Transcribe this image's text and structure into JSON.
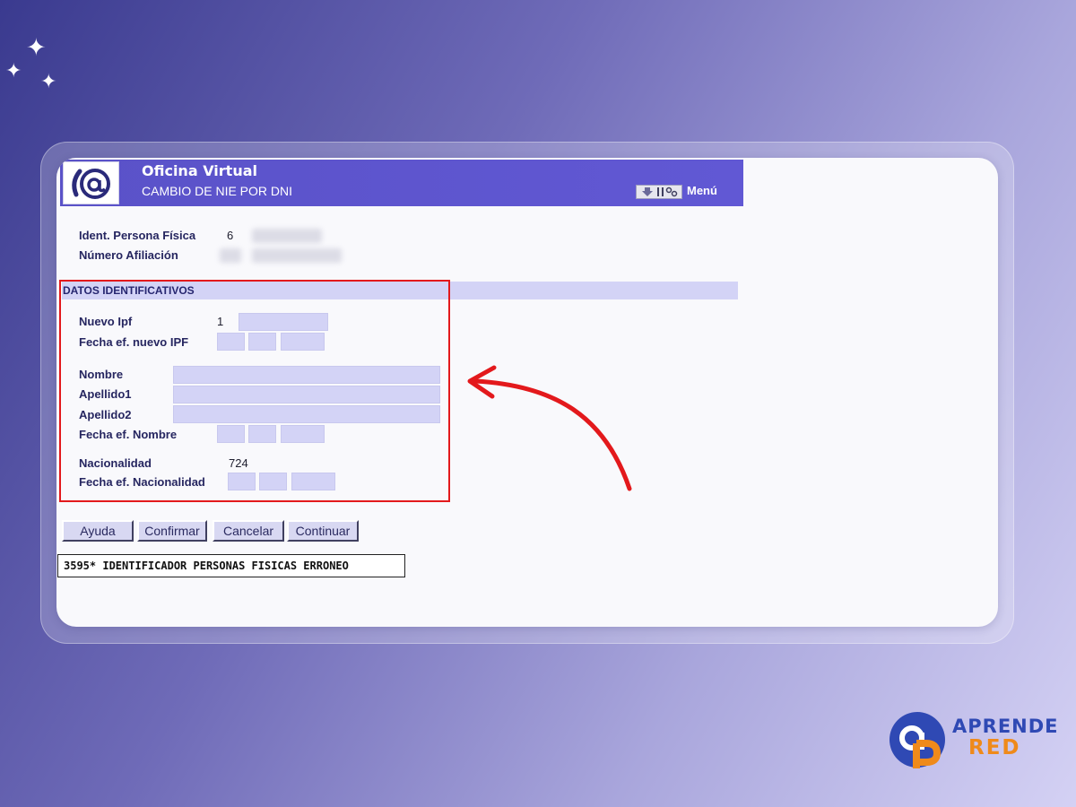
{
  "app": {
    "title": "Oficina Virtual",
    "subtitle": "CAMBIO DE NIE POR DNI",
    "logo_icon": "at-sign-logo-icon",
    "menu_label": "Menú",
    "menu_icon": "download-settings-icon"
  },
  "identity": {
    "ident_label": "Ident. Persona Física",
    "ident_value": "6",
    "afiliacion_label": "Número Afiliación"
  },
  "section": {
    "title": "DATOS IDENTIFICATIVOS",
    "nuevo_ipf_label": "Nuevo Ipf",
    "nuevo_ipf_prefix": "1",
    "fecha_nuevo_ipf_label": "Fecha ef. nuevo IPF",
    "nombre_label": "Nombre",
    "apellido1_label": "Apellido1",
    "apellido2_label": "Apellido2",
    "fecha_nombre_label": "Fecha ef. Nombre",
    "nacionalidad_label": "Nacionalidad",
    "nacionalidad_value": "724",
    "fecha_nacionalidad_label": "Fecha ef. Nacionalidad"
  },
  "buttons": {
    "ayuda": "Ayuda",
    "confirmar": "Confirmar",
    "cancelar": "Cancelar",
    "continuar": "Continuar"
  },
  "error_message": "3595* IDENTIFICADOR PERSONAS FISICAS ERRONEO",
  "brand": {
    "line1": "APRENDE",
    "line2": "RED",
    "blue": "#2f49b4",
    "orange": "#ef8a1a"
  },
  "colors": {
    "header_purple": "#5a52c8",
    "field_lavender": "#d3d3f6",
    "highlight_red": "#e3191c"
  }
}
